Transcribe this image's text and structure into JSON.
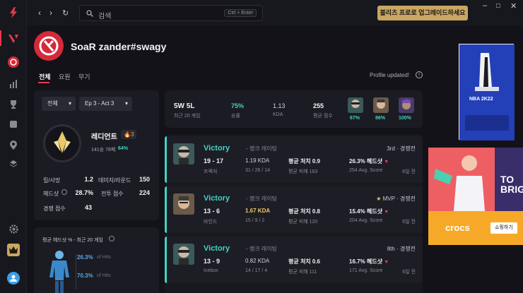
{
  "topbar": {
    "search_placeholder": "검색",
    "search_shortcut": "Ctrl + Enter",
    "upgrade_label": "블리츠 프로로 업그레이드하세요"
  },
  "profile": {
    "name": "SoaR zander#swagy",
    "tabs": [
      "전체",
      "요원",
      "무기"
    ],
    "status": "Profile updated!"
  },
  "filters": {
    "mode": "전체",
    "act": "Ep 3 - Act 3"
  },
  "rank": {
    "name": "레디언트",
    "rr": "3",
    "record": "141승 78패",
    "winrate": "64%"
  },
  "stats": [
    {
      "label": "킬/사망",
      "value": "1.2",
      "label2": "데미지/라운드",
      "value2": "150"
    },
    {
      "label": "헤드샷",
      "value": "28.7%",
      "label2": "전투 점수",
      "value2": "224"
    },
    {
      "label": "경쟁 점수",
      "value": "43",
      "label2": "",
      "value2": ""
    }
  ],
  "hs_panel": {
    "title": "평균 헤드샷 % - 최근 20 게임",
    "rows": [
      {
        "pct": "26.3%",
        "suffix": "of Hits"
      },
      {
        "pct": "70.3%",
        "suffix": "of Hits"
      }
    ]
  },
  "summary": {
    "wl": "5W 5L",
    "wl_sub": "최근 20 게임",
    "winrate": "75%",
    "winrate_label": "승률",
    "kda": "1.13",
    "kda_label": "KDA",
    "score": "255",
    "score_label": "평균 점수",
    "agents": [
      "67%",
      "86%",
      "100%"
    ]
  },
  "matches": [
    {
      "result": "Victory",
      "mode": "- 랭크 레이팅",
      "place": "3rd · 경쟁전",
      "score": "19 - 17",
      "map": "프랙처",
      "kda": "1.19 KDA",
      "kda_nums": "31 / 26 / 14",
      "hs_label": "평균 처치 0.9",
      "hs_sub": "평균 피해 163",
      "hp": "26.3% 헤드샷",
      "hp_sub": "254 Avg. Score",
      "ago": "6일 전"
    },
    {
      "result": "Victory",
      "mode": "- 랭크 레이팅",
      "place": "MVP · 경쟁전",
      "score": "13 - 6",
      "map": "바인드",
      "kda": "1.67 KDA",
      "kda_nums": "15 / 9 / 2",
      "hs_label": "평균 처치 0.8",
      "hs_sub": "평균 피해 120",
      "hp": "15.4% 헤드샷",
      "hp_sub": "204 Avg. Score",
      "ago": "6일 전"
    },
    {
      "result": "Victory",
      "mode": "- 랭크 레이팅",
      "place": "8th · 경쟁전",
      "score": "13 - 9",
      "map": "Icebox",
      "kda": "0.82 KDA",
      "kda_nums": "14 / 17 / 4",
      "hs_label": "평균 처치 0.6",
      "hs_sub": "평균 피해 111",
      "hp": "16.7% 헤드샷",
      "hp_sub": "171 Avg. Score",
      "ago": "6일 전"
    }
  ],
  "ads": {
    "ad1_text": "NBA 2K22",
    "ad2_brand": "crocs",
    "ad2_cta": "쇼핑하기",
    "ad2_big": "TO BRIG"
  }
}
